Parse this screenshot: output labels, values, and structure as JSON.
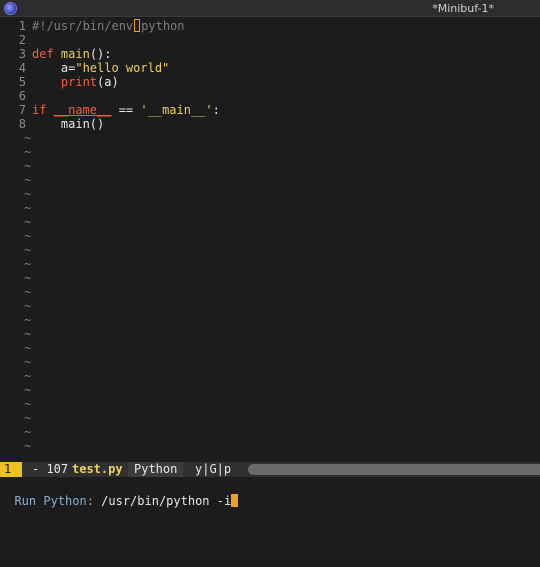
{
  "window": {
    "title": "*Minibuf-1*",
    "icon": "emacs-icon"
  },
  "editor": {
    "lines": [
      {
        "num": "1",
        "tokens": [
          {
            "t": "#!/usr/bin/env",
            "c": "comment"
          },
          {
            "t": "CURSORBOX"
          },
          {
            "t": "python",
            "c": "comment"
          }
        ]
      },
      {
        "num": "2",
        "tokens": []
      },
      {
        "num": "3",
        "tokens": [
          {
            "t": "def",
            "c": "kw"
          },
          {
            "t": " ",
            "c": "op"
          },
          {
            "t": "main",
            "c": "fn"
          },
          {
            "t": "():",
            "c": "op"
          }
        ]
      },
      {
        "num": "4",
        "tokens": [
          {
            "t": "    a=",
            "c": "op"
          },
          {
            "t": "\"hello world\"",
            "c": "str"
          }
        ]
      },
      {
        "num": "5",
        "tokens": [
          {
            "t": "    ",
            "c": "op"
          },
          {
            "t": "print",
            "c": "builtin"
          },
          {
            "t": "(a)",
            "c": "op"
          }
        ]
      },
      {
        "num": "6",
        "tokens": []
      },
      {
        "num": "7",
        "tokens": [
          {
            "t": "if",
            "c": "kw"
          },
          {
            "t": " ",
            "c": "op"
          },
          {
            "t": "__name__",
            "c": "dunder"
          },
          {
            "t": " == ",
            "c": "op"
          },
          {
            "t": "'__main__'",
            "c": "str"
          },
          {
            "t": ":",
            "c": "op"
          }
        ]
      },
      {
        "num": "8",
        "tokens": [
          {
            "t": "    main()",
            "c": "op"
          }
        ]
      }
    ],
    "tilde": "~",
    "tilde_count": 23
  },
  "modeline": {
    "window_number": "1",
    "status": "- 107",
    "filename": "test.py",
    "mode": "Python",
    "extra": "y|G|p"
  },
  "minibuffer": {
    "prompt": "Run Python: ",
    "value": "/usr/bin/python -i"
  },
  "colors": {
    "background": "#1c1c1c",
    "keyword": "#f06040",
    "string": "#e8d060",
    "cursor": "#f0a020",
    "modeline_accent": "#f0c020"
  }
}
